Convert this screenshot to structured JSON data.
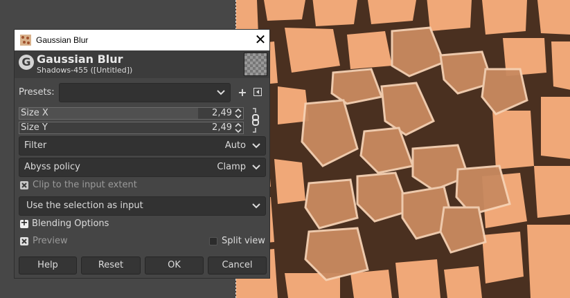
{
  "window": {
    "title": "Gaussian Blur",
    "close_glyph": "✕"
  },
  "header": {
    "logo_glyph": "G",
    "title": "Gaussian Blur",
    "subtitle": "Shadows-455 ([Untitled])"
  },
  "presets": {
    "label": "Presets:",
    "value": "",
    "add_glyph": "+",
    "menu_icon": "menu-icon"
  },
  "size_x": {
    "label": "Size X",
    "value": "2,49",
    "fraction": 0.8
  },
  "size_y": {
    "label": "Size Y",
    "value": "2,49",
    "fraction": 0.0
  },
  "filter": {
    "label": "Filter",
    "value": "Auto"
  },
  "abyss": {
    "label": "Abyss policy",
    "value": "Clamp"
  },
  "clip": {
    "label": "Clip to the input extent",
    "checked": true
  },
  "input_source": {
    "value": "Use the selection as input"
  },
  "blending": {
    "label": "Blending Options",
    "expander_glyph": "+"
  },
  "preview": {
    "label": "Preview",
    "checked": true
  },
  "split_view": {
    "label": "Split view",
    "checked": false
  },
  "buttons": {
    "help": "Help",
    "reset": "Reset",
    "ok": "OK",
    "cancel": "Cancel"
  },
  "colors": {
    "dialog_bg": "#454545",
    "canvas_bg": "#474747",
    "stone": "#f0a878",
    "grout": "#4a3020"
  }
}
